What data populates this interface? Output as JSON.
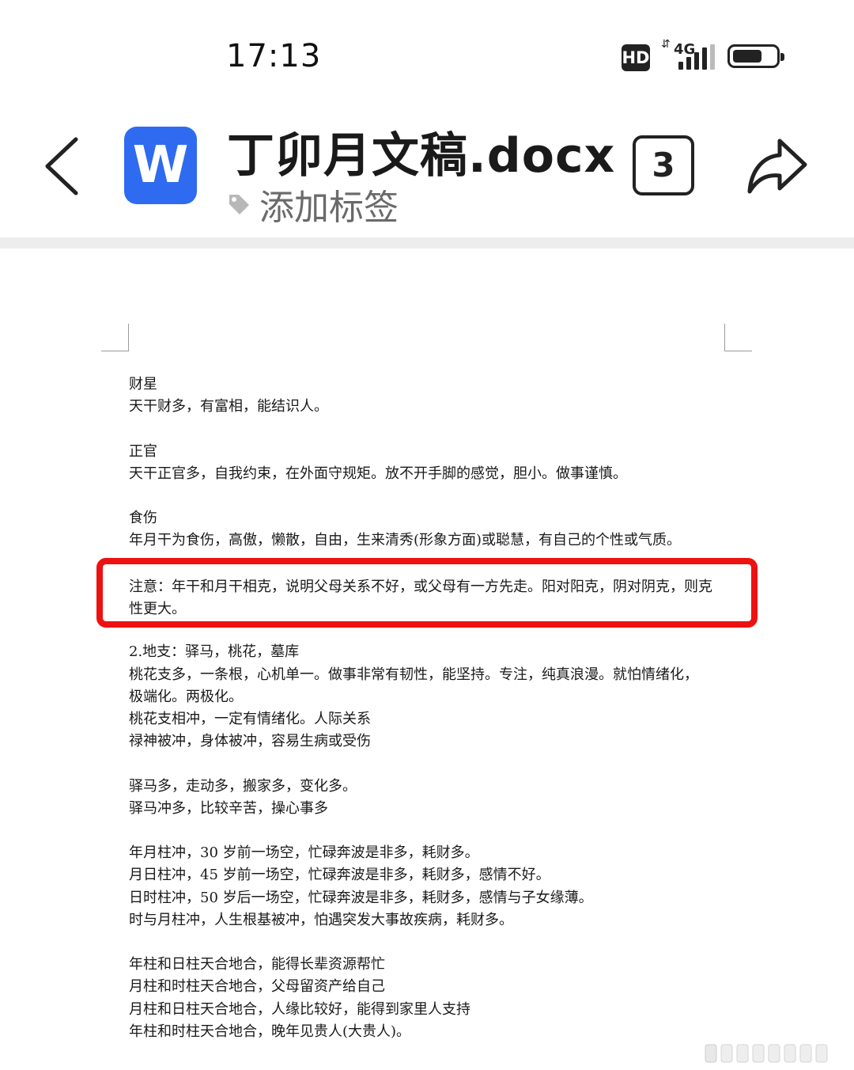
{
  "status_bar": {
    "time": "17:13",
    "hd": "HD",
    "network": "4G"
  },
  "header": {
    "app_icon_letter": "W",
    "file_title": "丁卯月文稿.docx",
    "tag_label": "添加标签",
    "count": "3",
    "colors": {
      "app_icon": "#2f6bf0",
      "highlight_box": "#ee1111"
    }
  },
  "document": {
    "sections": [
      {
        "lines": [
          "财星",
          "天干财多，有富相，能结识人。"
        ]
      },
      {
        "lines": [
          "正官",
          "天干正官多，自我约束，在外面守规矩。放不开手脚的感觉，胆小。做事谨慎。"
        ]
      },
      {
        "lines": [
          "食伤",
          "年月干为食伤，高傲，懒散，自由，生来清秀(形象方面)或聪慧，有自己的个性或气质。"
        ]
      }
    ],
    "note": {
      "line1": "注意：年干和月干相克，说明父母关系不好，或父母有一方先走。阳对阳克，阴对阴克，则克",
      "line2": "性更大。"
    },
    "sections_after": [
      {
        "lines": [
          "2.地支：驿马，桃花，墓库",
          "桃花支多，一条根，心机单一。做事非常有韧性，能坚持。专注，纯真浪漫。就怕情绪化，",
          "极端化。两极化。",
          "桃花支相冲，一定有情绪化。人际关系",
          "禄神被冲，身体被冲，容易生病或受伤"
        ]
      },
      {
        "lines": [
          "驿马多，走动多，搬家多，变化多。",
          "驿马冲多，比较辛苦，操心事多"
        ]
      },
      {
        "lines": [
          "年月柱冲，30 岁前一场空，忙碌奔波是非多，耗财多。",
          "月日柱冲，45 岁前一场空，忙碌奔波是非多，耗财多，感情不好。",
          "日时柱冲，50 岁后一场空，忙碌奔波是非多，耗财多，感情与子女缘薄。",
          "时与月柱冲，人生根基被冲，怕遇突发大事故疾病，耗财多。"
        ]
      },
      {
        "lines": [
          "年柱和日柱天合地合，能得长辈资源帮忙",
          "月柱和时柱天合地合，父母留资产给自己",
          "月柱和日柱天合地合，人缘比较好，能得到家里人支持",
          "年柱和时柱天合地合，晚年见贵人(大贵人)。"
        ]
      }
    ]
  }
}
